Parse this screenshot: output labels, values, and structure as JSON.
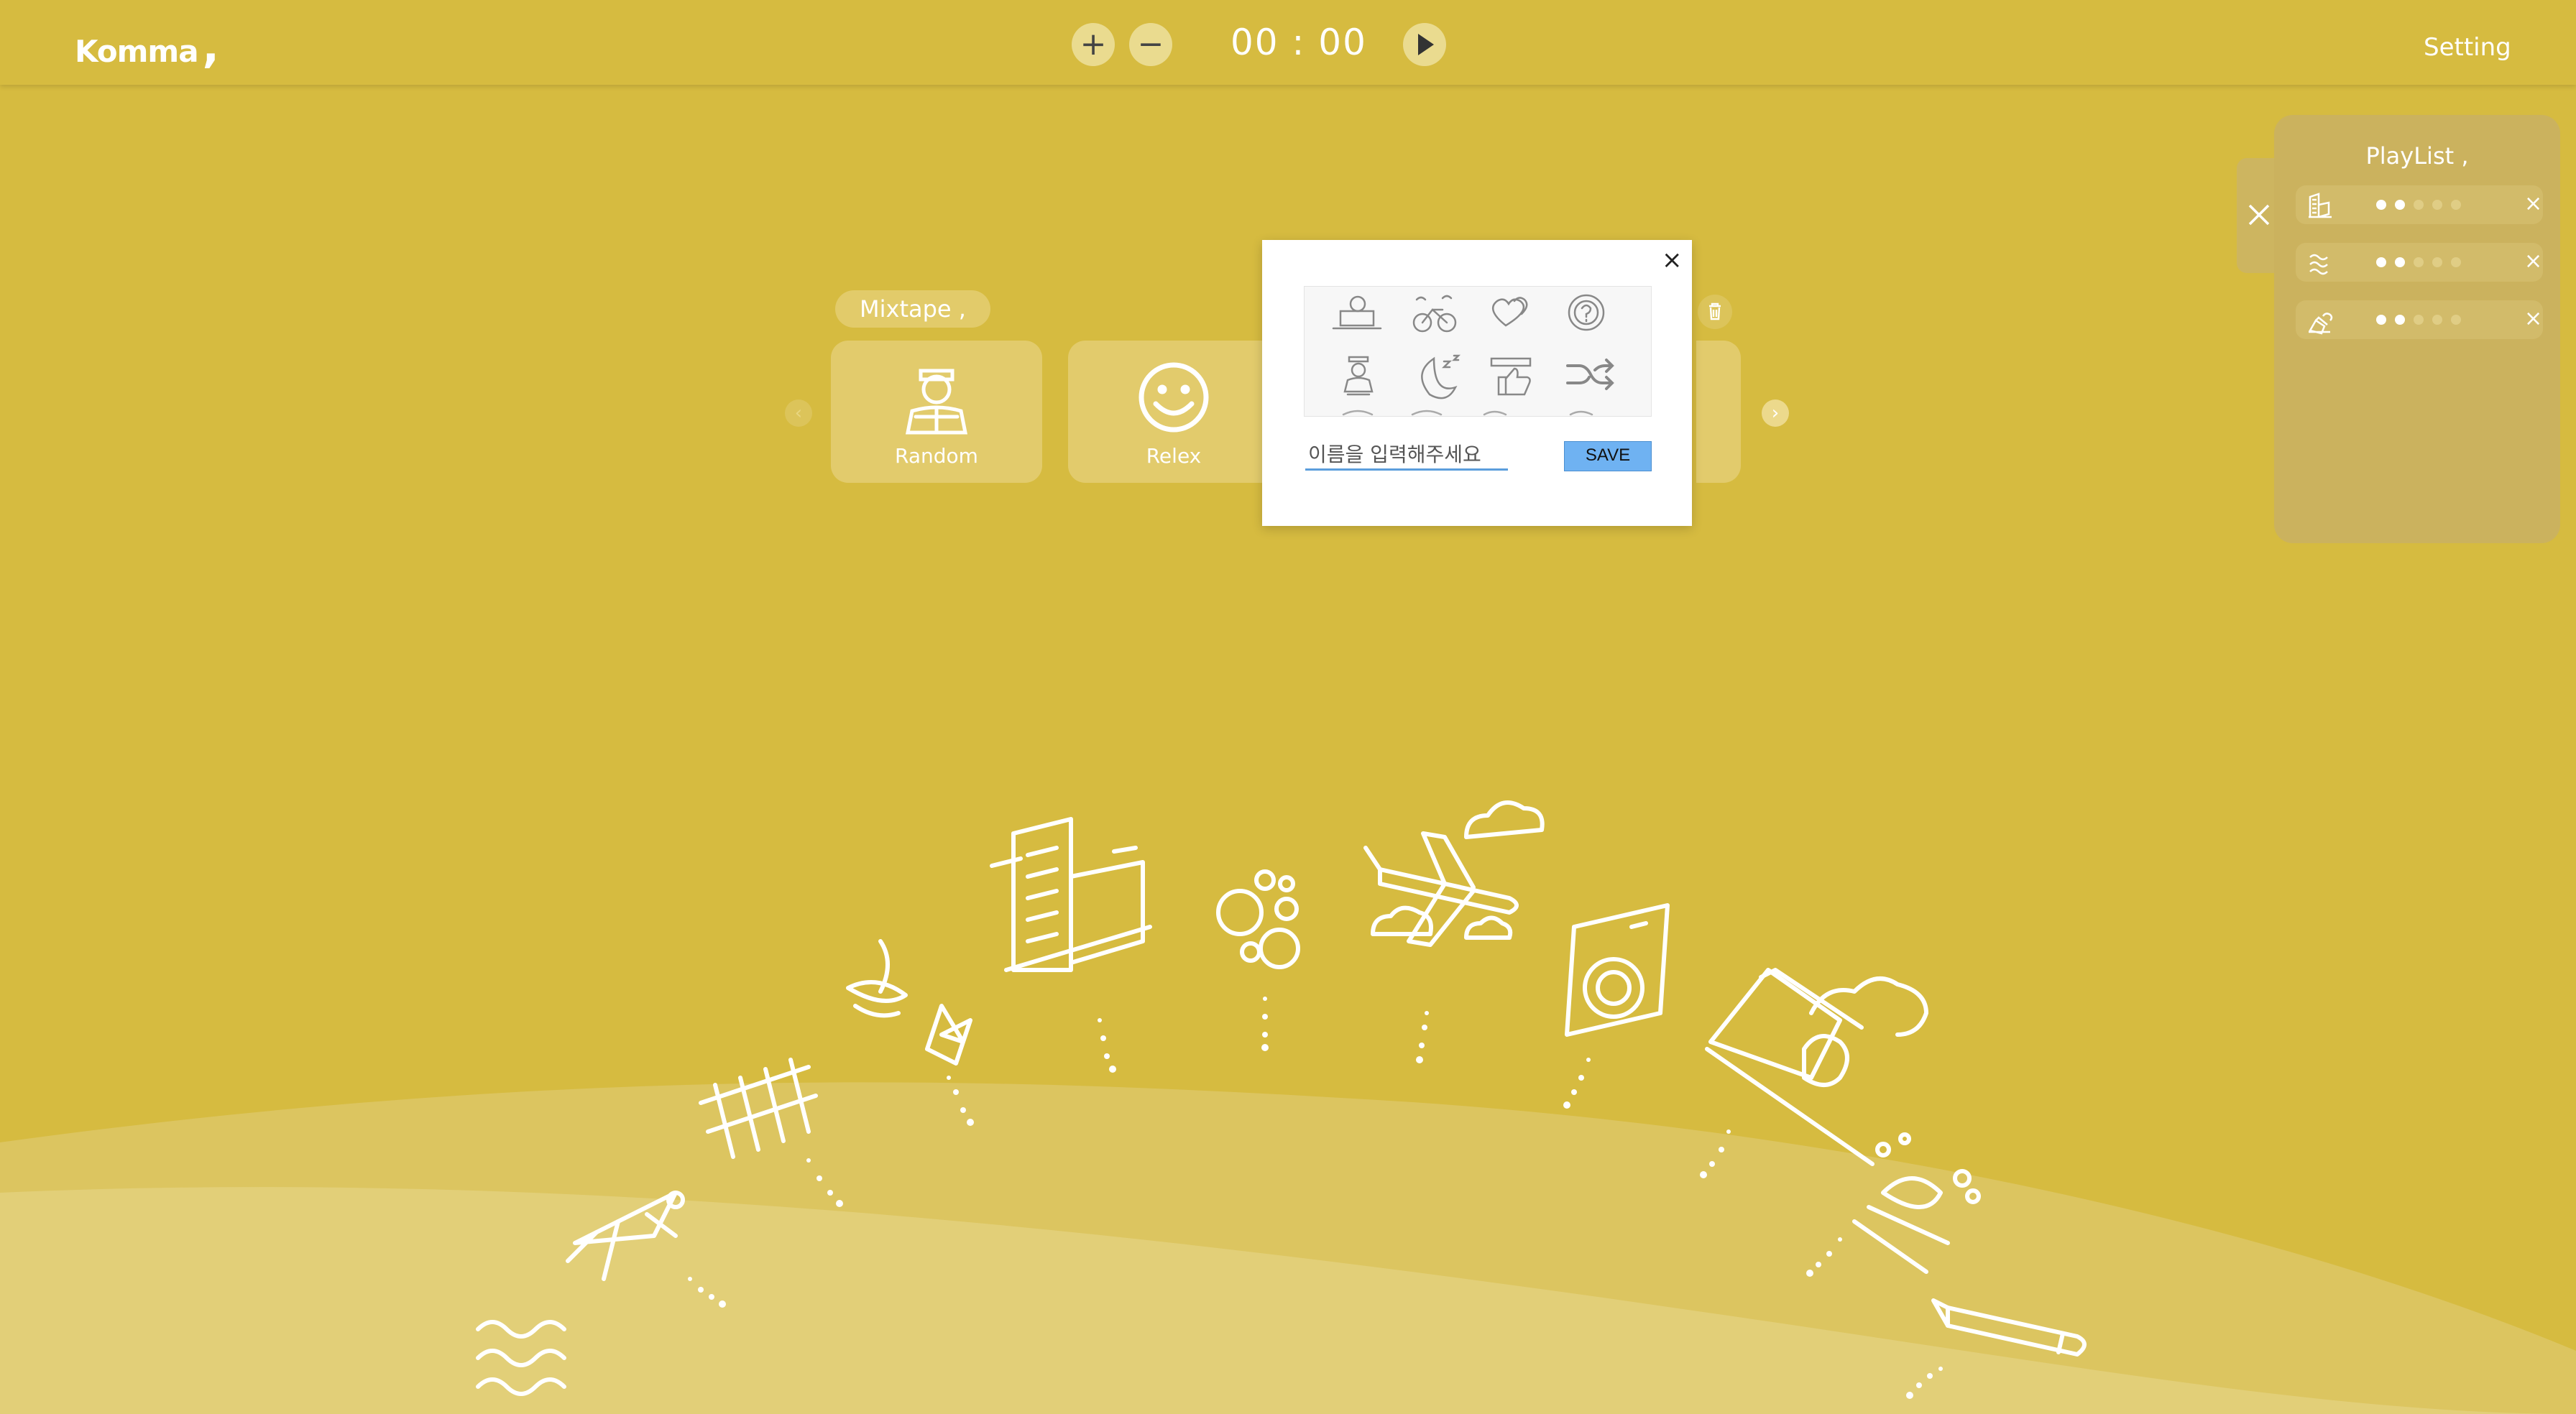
{
  "header": {
    "logo": "Komma",
    "logo_mark": ",",
    "plus_label": "+",
    "minus_label": "−",
    "timer": "00 : 00",
    "setting_label": "Setting"
  },
  "mixtape": {
    "tag_label": "Mixtape ,",
    "cards": [
      {
        "label": "Random",
        "icon": "reading-person-icon"
      },
      {
        "label": "Relex",
        "icon": "smile-icon"
      }
    ]
  },
  "playlist": {
    "title": "PlayList ,",
    "items": [
      {
        "icon": "city-buildings-icon",
        "level": 2,
        "max": 5
      },
      {
        "icon": "sound-waves-icon",
        "level": 2,
        "max": 5
      },
      {
        "icon": "house-icon",
        "level": 2,
        "max": 5
      }
    ]
  },
  "modal": {
    "icons": [
      "computer-user-icon",
      "bicycle-icon",
      "hearts-icon",
      "question-bubble-icon",
      "student-icon",
      "moon-sleep-icon",
      "thumbs-up-icon",
      "shuffle-icon"
    ],
    "input_placeholder": "이름을 입력해주세요",
    "save_label": "SAVE"
  },
  "scene_icons": [
    "waves-icon",
    "grasshopper-icon",
    "fence-icon",
    "leaves-icon",
    "buildings-icon",
    "bubbles-icon",
    "airplane-icon",
    "washing-machine-icon",
    "house-smoke-icon",
    "campfire-icon",
    "pencil-icon"
  ],
  "colors": {
    "background": "#d6bb40",
    "hill_light": "#e0cc6c",
    "hill_lighter": "#e6d683",
    "save_button": "#6fb2f2"
  }
}
